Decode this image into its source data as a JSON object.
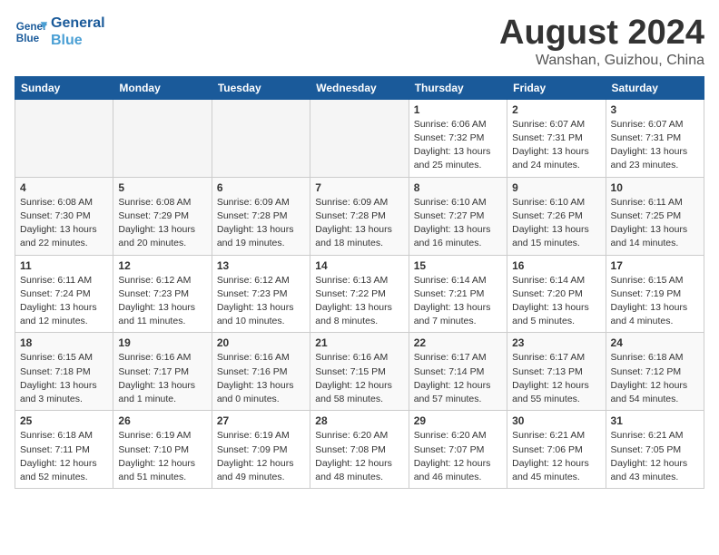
{
  "logo": {
    "line1": "General",
    "line2": "Blue"
  },
  "title": "August 2024",
  "location": "Wanshan, Guizhou, China",
  "weekdays": [
    "Sunday",
    "Monday",
    "Tuesday",
    "Wednesday",
    "Thursday",
    "Friday",
    "Saturday"
  ],
  "weeks": [
    [
      {
        "day": "",
        "info": ""
      },
      {
        "day": "",
        "info": ""
      },
      {
        "day": "",
        "info": ""
      },
      {
        "day": "",
        "info": ""
      },
      {
        "day": "1",
        "info": "Sunrise: 6:06 AM\nSunset: 7:32 PM\nDaylight: 13 hours\nand 25 minutes."
      },
      {
        "day": "2",
        "info": "Sunrise: 6:07 AM\nSunset: 7:31 PM\nDaylight: 13 hours\nand 24 minutes."
      },
      {
        "day": "3",
        "info": "Sunrise: 6:07 AM\nSunset: 7:31 PM\nDaylight: 13 hours\nand 23 minutes."
      }
    ],
    [
      {
        "day": "4",
        "info": "Sunrise: 6:08 AM\nSunset: 7:30 PM\nDaylight: 13 hours\nand 22 minutes."
      },
      {
        "day": "5",
        "info": "Sunrise: 6:08 AM\nSunset: 7:29 PM\nDaylight: 13 hours\nand 20 minutes."
      },
      {
        "day": "6",
        "info": "Sunrise: 6:09 AM\nSunset: 7:28 PM\nDaylight: 13 hours\nand 19 minutes."
      },
      {
        "day": "7",
        "info": "Sunrise: 6:09 AM\nSunset: 7:28 PM\nDaylight: 13 hours\nand 18 minutes."
      },
      {
        "day": "8",
        "info": "Sunrise: 6:10 AM\nSunset: 7:27 PM\nDaylight: 13 hours\nand 16 minutes."
      },
      {
        "day": "9",
        "info": "Sunrise: 6:10 AM\nSunset: 7:26 PM\nDaylight: 13 hours\nand 15 minutes."
      },
      {
        "day": "10",
        "info": "Sunrise: 6:11 AM\nSunset: 7:25 PM\nDaylight: 13 hours\nand 14 minutes."
      }
    ],
    [
      {
        "day": "11",
        "info": "Sunrise: 6:11 AM\nSunset: 7:24 PM\nDaylight: 13 hours\nand 12 minutes."
      },
      {
        "day": "12",
        "info": "Sunrise: 6:12 AM\nSunset: 7:23 PM\nDaylight: 13 hours\nand 11 minutes."
      },
      {
        "day": "13",
        "info": "Sunrise: 6:12 AM\nSunset: 7:23 PM\nDaylight: 13 hours\nand 10 minutes."
      },
      {
        "day": "14",
        "info": "Sunrise: 6:13 AM\nSunset: 7:22 PM\nDaylight: 13 hours\nand 8 minutes."
      },
      {
        "day": "15",
        "info": "Sunrise: 6:14 AM\nSunset: 7:21 PM\nDaylight: 13 hours\nand 7 minutes."
      },
      {
        "day": "16",
        "info": "Sunrise: 6:14 AM\nSunset: 7:20 PM\nDaylight: 13 hours\nand 5 minutes."
      },
      {
        "day": "17",
        "info": "Sunrise: 6:15 AM\nSunset: 7:19 PM\nDaylight: 13 hours\nand 4 minutes."
      }
    ],
    [
      {
        "day": "18",
        "info": "Sunrise: 6:15 AM\nSunset: 7:18 PM\nDaylight: 13 hours\nand 3 minutes."
      },
      {
        "day": "19",
        "info": "Sunrise: 6:16 AM\nSunset: 7:17 PM\nDaylight: 13 hours\nand 1 minute."
      },
      {
        "day": "20",
        "info": "Sunrise: 6:16 AM\nSunset: 7:16 PM\nDaylight: 13 hours\nand 0 minutes."
      },
      {
        "day": "21",
        "info": "Sunrise: 6:16 AM\nSunset: 7:15 PM\nDaylight: 12 hours\nand 58 minutes."
      },
      {
        "day": "22",
        "info": "Sunrise: 6:17 AM\nSunset: 7:14 PM\nDaylight: 12 hours\nand 57 minutes."
      },
      {
        "day": "23",
        "info": "Sunrise: 6:17 AM\nSunset: 7:13 PM\nDaylight: 12 hours\nand 55 minutes."
      },
      {
        "day": "24",
        "info": "Sunrise: 6:18 AM\nSunset: 7:12 PM\nDaylight: 12 hours\nand 54 minutes."
      }
    ],
    [
      {
        "day": "25",
        "info": "Sunrise: 6:18 AM\nSunset: 7:11 PM\nDaylight: 12 hours\nand 52 minutes."
      },
      {
        "day": "26",
        "info": "Sunrise: 6:19 AM\nSunset: 7:10 PM\nDaylight: 12 hours\nand 51 minutes."
      },
      {
        "day": "27",
        "info": "Sunrise: 6:19 AM\nSunset: 7:09 PM\nDaylight: 12 hours\nand 49 minutes."
      },
      {
        "day": "28",
        "info": "Sunrise: 6:20 AM\nSunset: 7:08 PM\nDaylight: 12 hours\nand 48 minutes."
      },
      {
        "day": "29",
        "info": "Sunrise: 6:20 AM\nSunset: 7:07 PM\nDaylight: 12 hours\nand 46 minutes."
      },
      {
        "day": "30",
        "info": "Sunrise: 6:21 AM\nSunset: 7:06 PM\nDaylight: 12 hours\nand 45 minutes."
      },
      {
        "day": "31",
        "info": "Sunrise: 6:21 AM\nSunset: 7:05 PM\nDaylight: 12 hours\nand 43 minutes."
      }
    ]
  ]
}
